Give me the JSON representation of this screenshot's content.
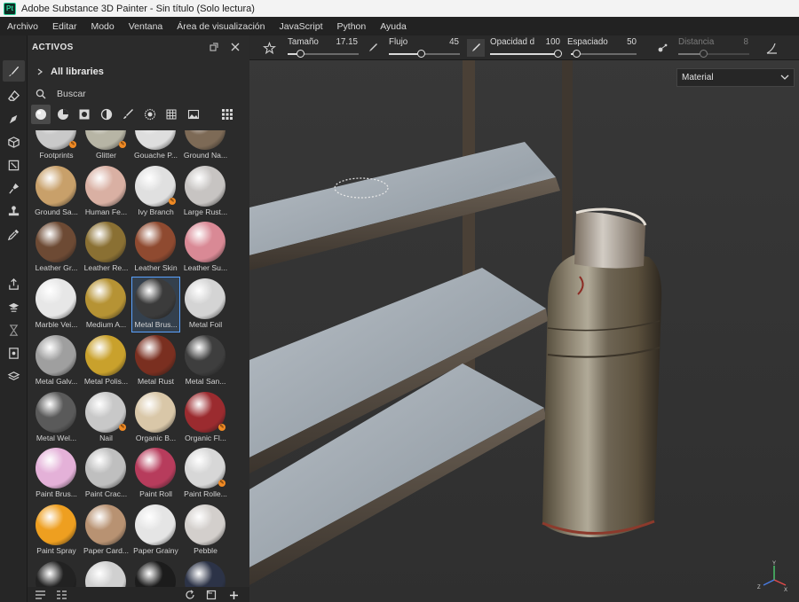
{
  "window": {
    "title": "Adobe Substance 3D Painter - Sin título (Solo lectura)",
    "logo": "Pt"
  },
  "menu": [
    "Archivo",
    "Editar",
    "Modo",
    "Ventana",
    "Área de visualización",
    "JavaScript",
    "Python",
    "Ayuda"
  ],
  "panel": {
    "title": "ACTIVOS",
    "libraries_label": "All libraries",
    "search_placeholder": "Buscar",
    "accent": "#f08a24",
    "selection_color": "#5aa2ff"
  },
  "assets": [
    {
      "label": "Footprints",
      "color": "#c9c9c9",
      "badge": true
    },
    {
      "label": "Glitter",
      "color": "#b7b5a5",
      "badge": true
    },
    {
      "label": "Gouache P...",
      "color": "#dedede",
      "badge": false
    },
    {
      "label": "Ground Na...",
      "color": "#7d6a56",
      "badge": false
    },
    {
      "label": "Ground Sa...",
      "color": "#c8a06a",
      "badge": false
    },
    {
      "label": "Human Fe...",
      "color": "#d9b0a3",
      "badge": false
    },
    {
      "label": "Ivy Branch",
      "color": "#e0e0e0",
      "badge": true
    },
    {
      "label": "Large Rust...",
      "color": "#c7c4c2",
      "badge": false
    },
    {
      "label": "Leather Gr...",
      "color": "#6d4a34",
      "badge": false
    },
    {
      "label": "Leather Re...",
      "color": "#8a7033",
      "badge": false
    },
    {
      "label": "Leather Skin",
      "color": "#8f4a30",
      "badge": false
    },
    {
      "label": "Leather Su...",
      "color": "#d98995",
      "badge": false
    },
    {
      "label": "Marble Vei...",
      "color": "#e7e7e7",
      "badge": false
    },
    {
      "label": "Medium A...",
      "color": "#b69334",
      "badge": false
    },
    {
      "label": "Metal Brus...",
      "color": "#3b3b3b",
      "badge": false
    },
    {
      "label": "Metal Foil",
      "color": "#d4d4d4",
      "badge": false
    },
    {
      "label": "Metal Galv...",
      "color": "#9f9f9f",
      "badge": false
    },
    {
      "label": "Metal Polis...",
      "color": "#c9a12c",
      "badge": false
    },
    {
      "label": "Metal Rust",
      "color": "#7a2f20",
      "badge": false
    },
    {
      "label": "Metal San...",
      "color": "#3e3e3e",
      "badge": false
    },
    {
      "label": "Metal Wel...",
      "color": "#5a5a5a",
      "badge": false
    },
    {
      "label": "Nail",
      "color": "#c8c8c8",
      "badge": true
    },
    {
      "label": "Organic B...",
      "color": "#d9c7a8",
      "badge": false
    },
    {
      "label": "Organic Fl...",
      "color": "#9b2b2f",
      "badge": true
    },
    {
      "label": "Paint Brus...",
      "color": "#e4b1d8",
      "badge": false
    },
    {
      "label": "Paint Crac...",
      "color": "#bfbfbf",
      "badge": false
    },
    {
      "label": "Paint Roll",
      "color": "#b73c5c",
      "badge": false
    },
    {
      "label": "Paint Rolle...",
      "color": "#d7d7d7",
      "badge": true
    },
    {
      "label": "Paint Spray",
      "color": "#ee9f20",
      "badge": false
    },
    {
      "label": "Paper Card...",
      "color": "#b89272",
      "badge": false
    },
    {
      "label": "Paper Grainy",
      "color": "#e5e5e5",
      "badge": false
    },
    {
      "label": "Pebble",
      "color": "#d3cfcc",
      "badge": false
    },
    {
      "label": "",
      "color": "#222222",
      "badge": false
    },
    {
      "label": "",
      "color": "#d0d0d0",
      "badge": false
    },
    {
      "label": "",
      "color": "#1c1c1c",
      "badge": false
    },
    {
      "label": "",
      "color": "#2c3347",
      "badge": false
    }
  ],
  "selected_asset": "Metal Brus...",
  "toolbar": {
    "size": {
      "label": "Tamaño",
      "value": "17.15",
      "fraction": 0.18
    },
    "flow": {
      "label": "Flujo",
      "value": "45",
      "fraction": 0.45
    },
    "opacity": {
      "label": "Opacidad d",
      "value": "100",
      "fraction": 1.0
    },
    "spacing": {
      "label": "Espaciado",
      "value": "50",
      "fraction": 0.08
    },
    "distance": {
      "label": "Distancia",
      "value": "8",
      "fraction": 0.35
    }
  },
  "viewport": {
    "channel_dropdown": "Material"
  }
}
